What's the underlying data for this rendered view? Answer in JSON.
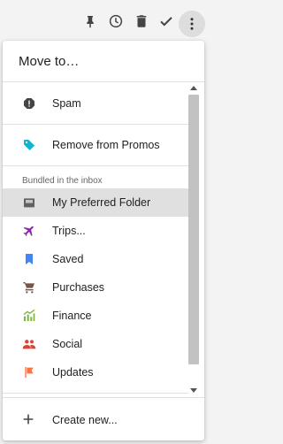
{
  "toolbar": {
    "icons": [
      "pin-icon",
      "snooze-clock-icon",
      "trash-icon",
      "done-check-icon",
      "more-vert-icon"
    ]
  },
  "menu": {
    "title": "Move to…",
    "items_top": [
      {
        "label": "Spam",
        "icon": "spam-icon",
        "color": "#444444"
      },
      {
        "label": "Remove from Promos",
        "icon": "promo-tag-icon",
        "color": "#12b5cb"
      }
    ],
    "section_title": "Bundled in the inbox",
    "bundles": [
      {
        "label": "My Preferred Folder",
        "icon": "folder-icon",
        "color": "#616161",
        "selected": true
      },
      {
        "label": "Trips...",
        "icon": "plane-icon",
        "color": "#8e24aa"
      },
      {
        "label": "Saved",
        "icon": "bookmark-icon",
        "color": "#4285f4"
      },
      {
        "label": "Purchases",
        "icon": "cart-icon",
        "color": "#795548"
      },
      {
        "label": "Finance",
        "icon": "finance-chart-icon",
        "color": "#7cb342"
      },
      {
        "label": "Social",
        "icon": "people-icon",
        "color": "#db4437"
      },
      {
        "label": "Updates",
        "icon": "flag-icon",
        "color": "#ff7043"
      }
    ],
    "footer_label": "Create new..."
  }
}
